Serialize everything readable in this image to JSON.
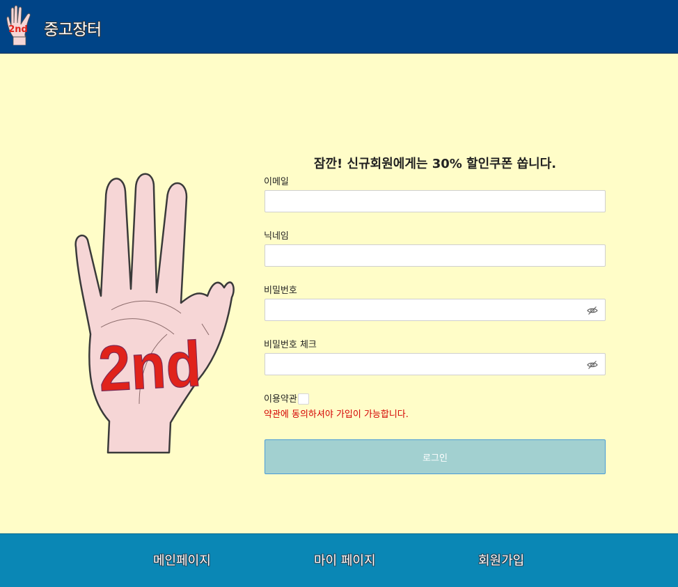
{
  "header": {
    "logo_text": "2nd",
    "brand": "중고장터"
  },
  "hero": {
    "hand_text": "2nd"
  },
  "form": {
    "headline": "잠깐! 신규회원에게는 30% 할인쿠폰 쏩니다.",
    "email_label": "이메일",
    "email_value": "",
    "nickname_label": "닉네임",
    "nickname_value": "",
    "password_label": "비밀번호",
    "password_value": "",
    "password_check_label": "비밀번호 체크",
    "password_check_value": "",
    "terms_label": "이용약관",
    "terms_checked": false,
    "terms_warning": "약관에 동의하셔야 가입이 가능합니다.",
    "submit_label": "로그인"
  },
  "footer": {
    "nav": [
      "메인페이지",
      "마이 페이지",
      "회원가입"
    ]
  },
  "colors": {
    "header_bg": "#004487",
    "page_bg": "#fffdc8",
    "footer_bg": "#0a87b5",
    "button_bg": "#a2d0d0",
    "warning": "#d40000",
    "hand_text": "#e0231b"
  }
}
